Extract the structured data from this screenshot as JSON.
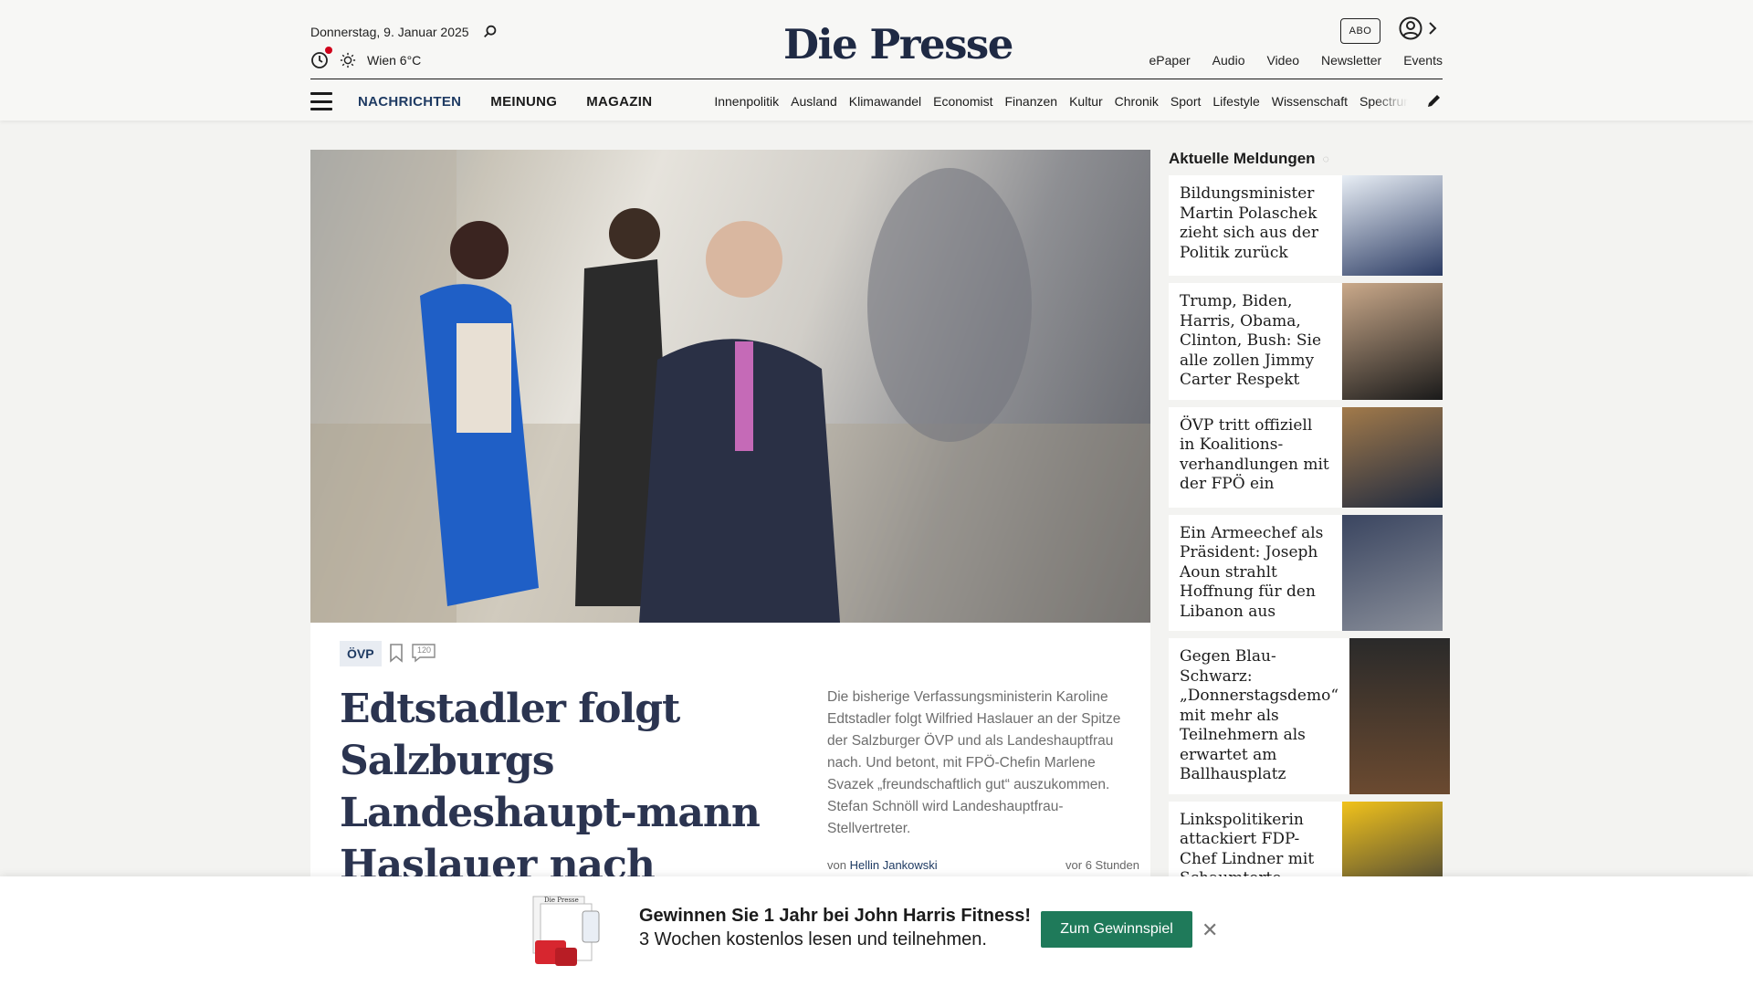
{
  "header": {
    "date": "Donnerstag, 9. Januar 2025",
    "weather": "Wien 6°C",
    "logo": "Die Presse",
    "abo": "ABO",
    "top_links": [
      "ePaper",
      "Audio",
      "Video",
      "Newsletter",
      "Events"
    ]
  },
  "nav": {
    "main": [
      "NACHRICHTEN",
      "MEINUNG",
      "MAGAZIN"
    ],
    "sub": [
      "Innenpolitik",
      "Ausland",
      "Klimawandel",
      "Economist",
      "Finanzen",
      "Kultur",
      "Chronik",
      "Sport",
      "Lifestyle",
      "Wissenschaft",
      "Spectrum"
    ]
  },
  "lead": {
    "tag": "ÖVP",
    "comments": "120",
    "headline": "Edtstadler folgt Salzburgs Landeshaupt-mann Haslauer nach",
    "teaser": "Die bisherige Verfassungsministerin Karoline Edtstadler folgt Wilfried Haslauer an der Spitze der Salzburger ÖVP und als Landeshauptfrau nach. Und betont, mit FPÖ-Chefin Marlene Svazek „freundschaftlich gut“ auszukommen. Stefan Schnöll wird Landeshauptfrau-Stellvertreter.",
    "byline_prefix": "von",
    "author": "Hellin Jankowski",
    "time": "vor 6 Stunden"
  },
  "sidebar": {
    "title": "Aktuelle Meldungen",
    "items": [
      {
        "title": "Bildungsminister Martin Polaschek zieht sich aus der Politik zurück"
      },
      {
        "title": "Trump, Biden, Harris, Obama, Clinton, Bush: Sie alle zollen Jimmy Carter Respekt"
      },
      {
        "title": "ÖVP tritt offiziell in Koalitions-verhandlungen mit der FPÖ ein"
      },
      {
        "title": "Ein Armeechef als Präsident: Joseph Aoun strahlt Hoffnung für den Libanon aus"
      },
      {
        "title": "Gegen Blau-Schwarz: „Donnerstagsdemo“ mit mehr als Teilnehmern als erwartet am Ballhausplatz"
      },
      {
        "title": "Linkspolitikerin attackiert FDP-Chef Lindner mit Schaumtorte"
      }
    ]
  },
  "banner": {
    "title": "Gewinnen Sie 1 Jahr bei John Harris Fitness!",
    "subtitle": "3 Wochen kostenlos lesen und teilnehmen.",
    "button": "Zum Gewinnspiel",
    "image_logo": "Die Presse"
  }
}
